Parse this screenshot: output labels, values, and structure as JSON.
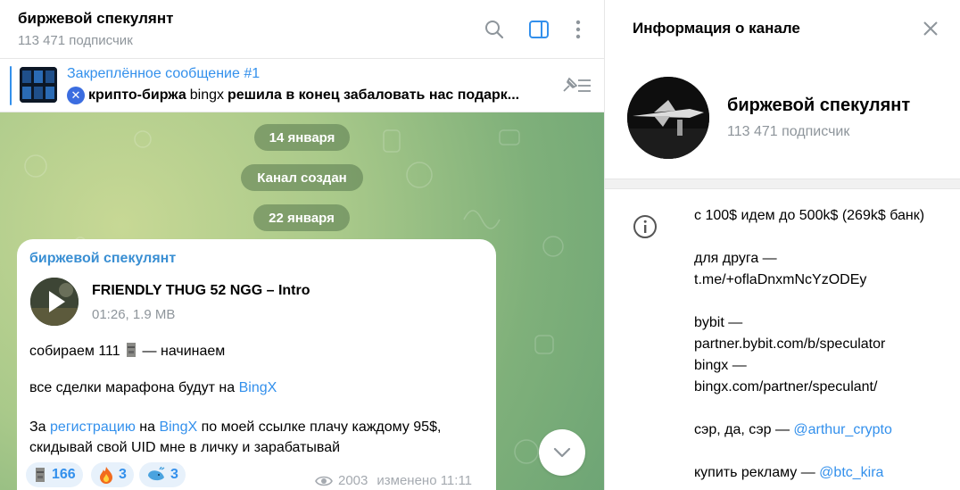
{
  "chat": {
    "title": "биржевой спекулянт",
    "subscribers": "113 471 подписчик"
  },
  "pinned": {
    "title": "Закреплённое сообщение #1",
    "text_bold1": "крипто-биржа",
    "text_normal": "bingx",
    "text_bold2": "решила в конец забаловать нас подарк..."
  },
  "service_messages": {
    "date1": "14 января",
    "created": "Канал создан",
    "date2": "22 января"
  },
  "message": {
    "author": "биржевой спекулянт",
    "audio_title": "FRIENDLY THUG 52 NGG – Intro",
    "audio_meta": "01:26, 1.9 MB",
    "line1_a": "собираем 111",
    "line1_b": " — начинаем",
    "line2_a": "все сделки марафона будут на ",
    "line2_link": "BingX",
    "line3_a": "За ",
    "line3_link1": "регистрацию",
    "line3_b": " на ",
    "line3_link2": "BingX",
    "line3_c": " по моей ссылке плачу каждому 95$,",
    "line4": "скидывай свой UID мне в личку и зарабатывай",
    "views": "2003",
    "edited": "изменено 11:11"
  },
  "reactions": [
    {
      "icon": "moai-icon",
      "count": "166"
    },
    {
      "icon": "fire-icon",
      "count": "3"
    },
    {
      "icon": "whale-icon",
      "count": "3"
    }
  ],
  "info": {
    "header": "Информация о канале",
    "name": "биржевой спекулянт",
    "subscribers": "113 471 подписчик",
    "desc1": "с 100$ идем до 500k$ (269k$ банк)",
    "desc2": "для друга —",
    "desc2_link": "t.me/+oflaDnxmNcYzODEy",
    "desc3": "bybit —",
    "desc3_link": "partner.bybit.com/b/speculator",
    "desc4": "bingx —",
    "desc4_link": "bingx.com/partner/speculant/",
    "desc5": "сэр, да, сэр — ",
    "desc5_link": "@arthur_crypto",
    "desc6": "купить рекламу — ",
    "desc6_link": "@btc_kira"
  },
  "colors": {
    "accent": "#3390ec",
    "author": "#3a8fd3",
    "muted": "#8e959b"
  }
}
